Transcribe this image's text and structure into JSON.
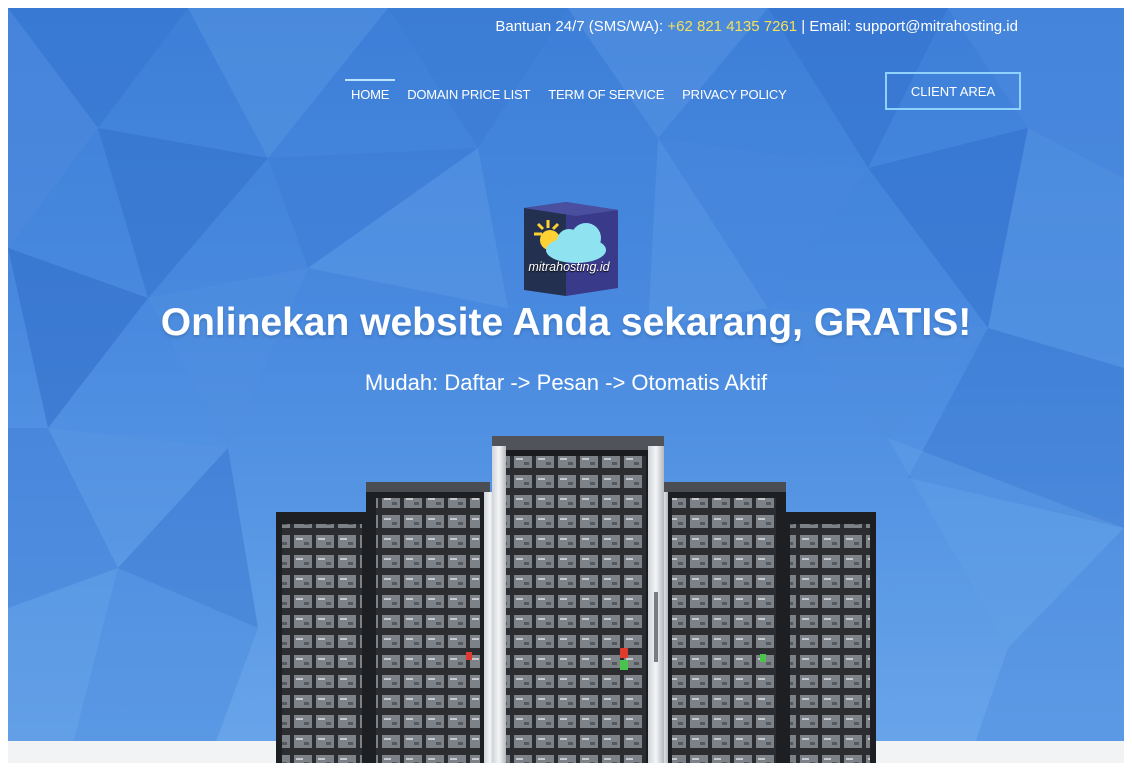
{
  "topbar": {
    "support_prefix": "Bantuan 24/7 (SMS/WA): ",
    "phone": "+62 821 4135 7261",
    "email_text": " | Email: support@mitrahosting.id"
  },
  "nav": {
    "items": [
      {
        "label": "HOME",
        "active": true
      },
      {
        "label": "DOMAIN PRICE LIST",
        "active": false
      },
      {
        "label": "TERM OF SERVICE",
        "active": false
      },
      {
        "label": "PRIVACY POLICY",
        "active": false
      }
    ],
    "client_area": "CLIENT AREA"
  },
  "logo": {
    "text": "mitrahosting.id"
  },
  "hero": {
    "headline": "Onlinekan website Anda sekarang, GRATIS!",
    "subheadline": "Mudah: Daftar -> Pesan -> Otomatis Aktif"
  },
  "colors": {
    "background": "#4a8be0",
    "phone_highlight": "#f6e05a",
    "button_border": "#8fd2ff"
  },
  "icons": [
    "cloud-sun-logo",
    "server-rack-image"
  ]
}
